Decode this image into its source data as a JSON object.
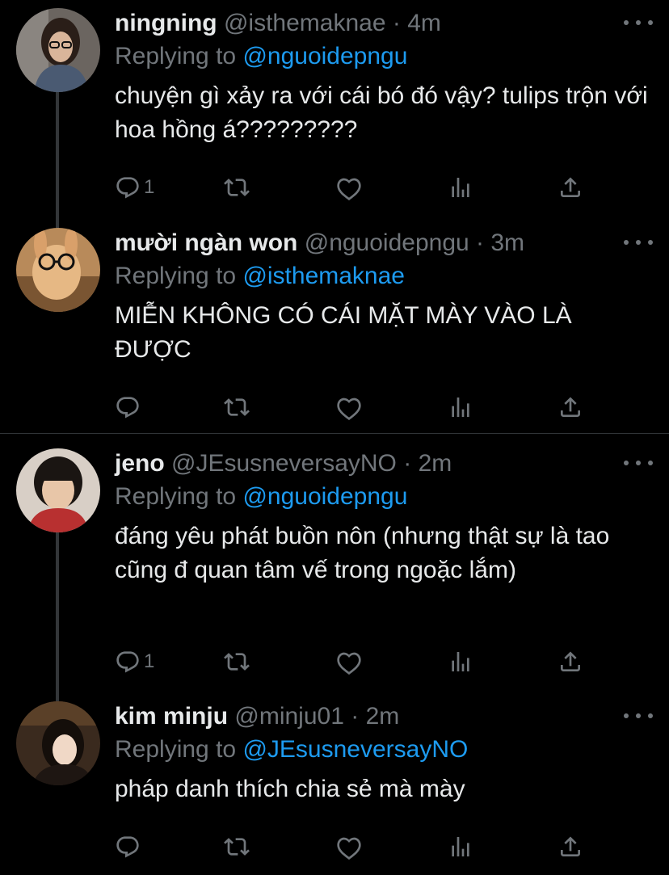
{
  "tweets": [
    {
      "name": "ningning",
      "handle": "@isthemaknae",
      "time": "4m",
      "replying_prefix": "Replying to ",
      "replying_to": "@nguoidepngu",
      "text": "chuyện gì xảy ra với cái bó đó vậy? tulips trộn với hoa hồng á?????????",
      "reply_count": "1"
    },
    {
      "name": "mười ngàn won",
      "handle": "@nguoidepngu",
      "time": "3m",
      "replying_prefix": "Replying to ",
      "replying_to": "@isthemaknae",
      "text": "MIỄN KHÔNG CÓ CÁI MẶT MÀY VÀO LÀ ĐƯỢC",
      "reply_count": ""
    },
    {
      "name": "jeno",
      "handle": "@JEsusneversayNO",
      "time": "2m",
      "replying_prefix": "Replying to ",
      "replying_to": "@nguoidepngu",
      "text": "đáng yêu phát buồn nôn (nhưng thật sự là tao cũng đ quan tâm vế trong ngoặc lắm)",
      "reply_count": "1"
    },
    {
      "name": "kim minju",
      "handle": "@minju01",
      "time": "2m",
      "replying_prefix": "Replying to ",
      "replying_to": "@JEsusneversayNO",
      "text": "pháp danh thích chia sẻ mà mày",
      "reply_count": ""
    }
  ],
  "separator": " · ",
  "icons": {
    "reply": "reply-icon",
    "retweet": "retweet-icon",
    "like": "heart-icon",
    "views": "analytics-icon",
    "share": "share-icon",
    "more": "more-icon"
  },
  "colors": {
    "background": "#000000",
    "text": "#e7e9ea",
    "muted": "#71767b",
    "link": "#1d9bf0"
  }
}
